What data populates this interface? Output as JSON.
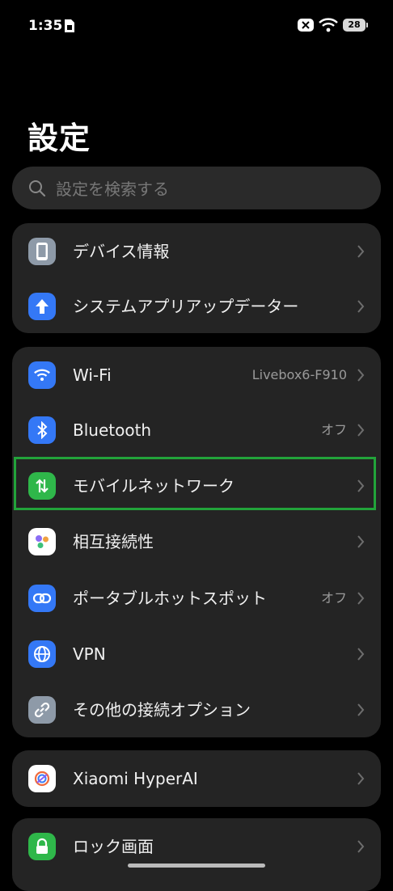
{
  "status_bar": {
    "time": "1:35",
    "battery": "28"
  },
  "page": {
    "title": "設定"
  },
  "search": {
    "placeholder": "設定を検索する"
  },
  "cards": {
    "device": {
      "about": "デバイス情報",
      "system_update": "システムアプリアップデーター"
    },
    "connectivity": {
      "wifi": {
        "label": "Wi-Fi",
        "value": "Livebox6-F910"
      },
      "bluetooth": {
        "label": "Bluetooth",
        "value": "オフ"
      },
      "mobile_network": {
        "label": "モバイルネットワーク"
      },
      "interconnectivity": {
        "label": "相互接続性"
      },
      "hotspot": {
        "label": "ポータブルホットスポット",
        "value": "オフ"
      },
      "vpn": {
        "label": "VPN"
      },
      "more_connection": {
        "label": "その他の接続オプション"
      }
    },
    "ai": {
      "hyperai": "Xiaomi HyperAI"
    },
    "security": {
      "lock_screen": "ロック画面"
    }
  },
  "colors": {
    "blue_icon": "#3478f6",
    "green_icon": "#2fb74a",
    "highlight": "#22a33a"
  }
}
